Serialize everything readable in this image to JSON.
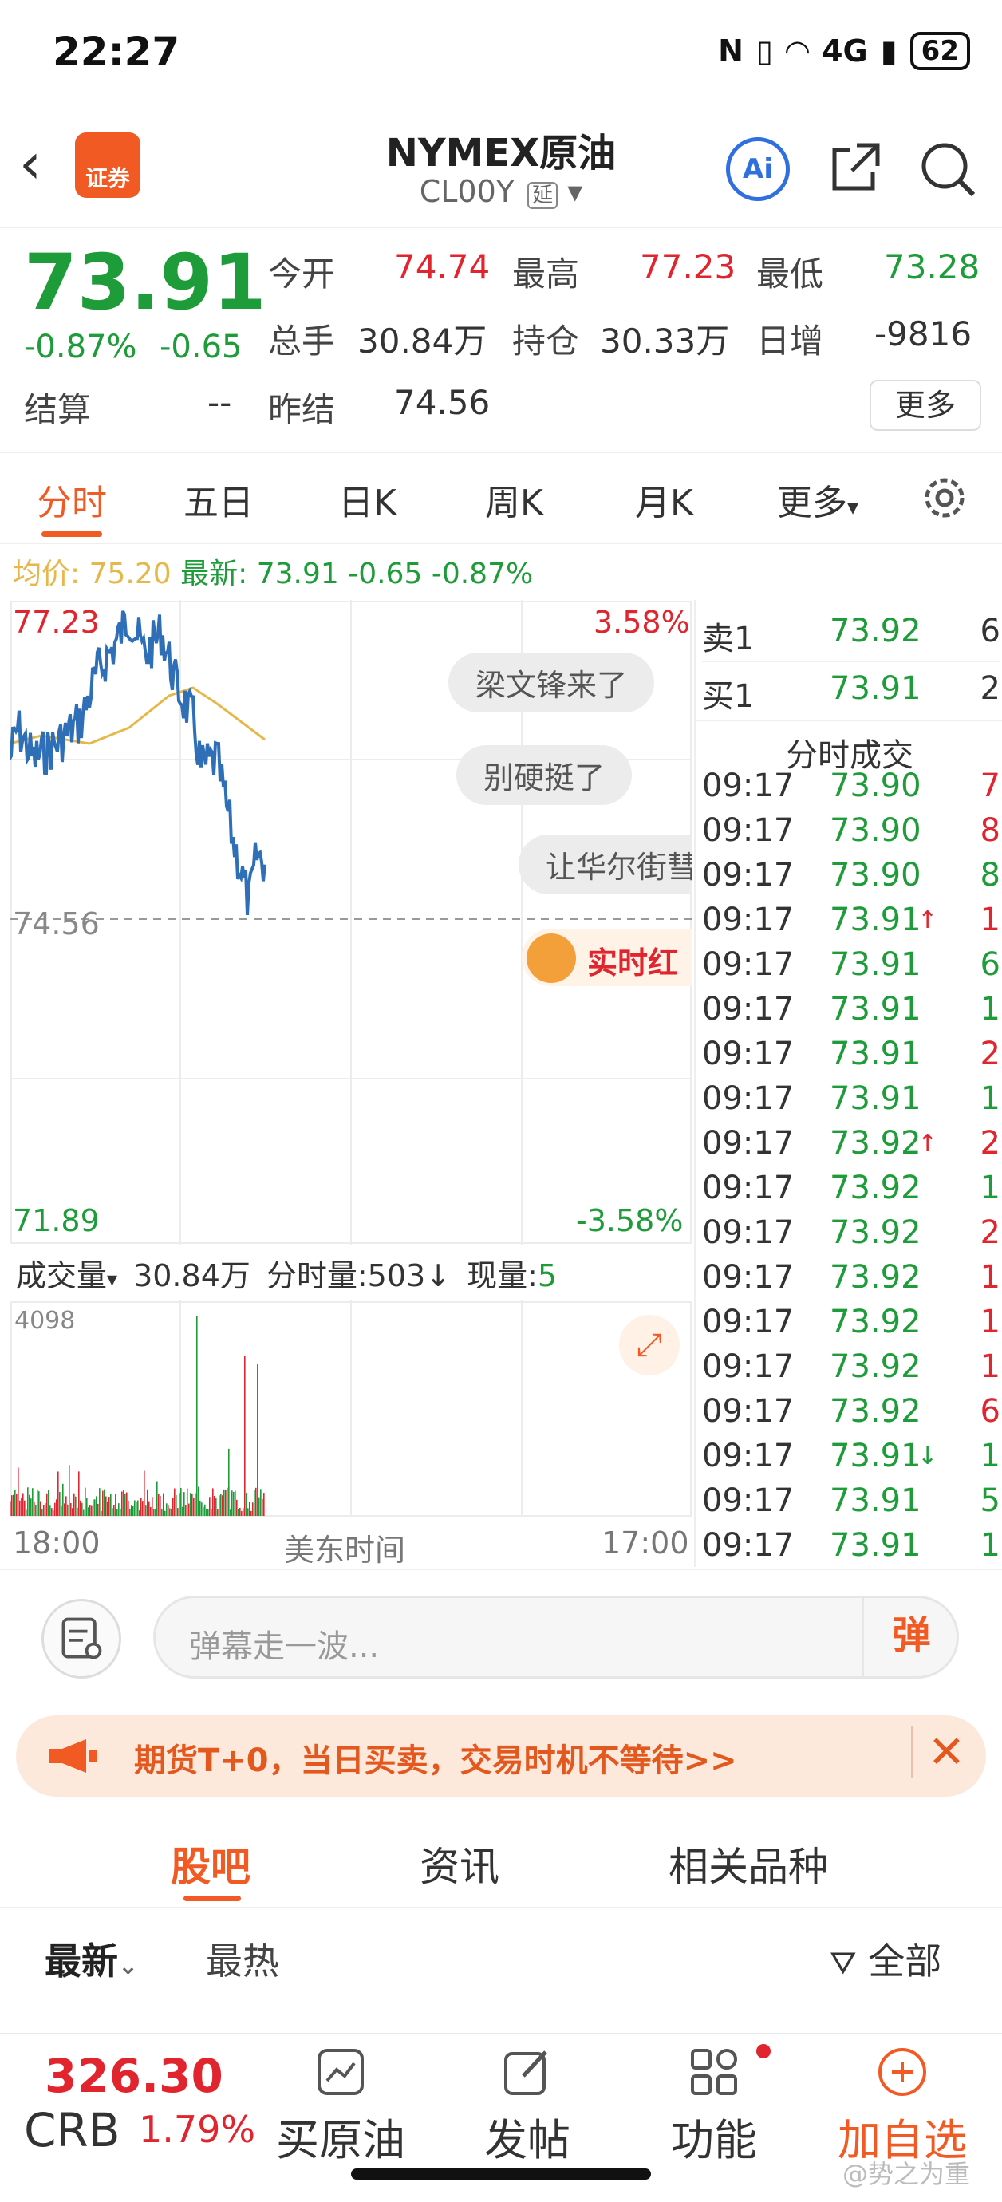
{
  "status_bar": {
    "time": "22:27",
    "network": "4G",
    "battery": "62"
  },
  "header": {
    "title": "NYMEX原油",
    "code": "CL00Y",
    "code_tag": "延",
    "broker_logo": "证券",
    "ai_label": "Ai"
  },
  "quote": {
    "last": "73.91",
    "change_pct": "-0.87%",
    "change_abs": "-0.65",
    "fields": [
      {
        "label": "今开",
        "value": "74.74",
        "color": "red"
      },
      {
        "label": "最高",
        "value": "77.23",
        "color": "red"
      },
      {
        "label": "最低",
        "value": "73.28",
        "color": "green"
      },
      {
        "label": "总手",
        "value": "30.84万",
        "color": "dark"
      },
      {
        "label": "持仓",
        "value": "30.33万",
        "color": "dark"
      },
      {
        "label": "日增",
        "value": "-9816",
        "color": "dark"
      }
    ],
    "settle_label": "结算",
    "settle_value": "--",
    "prev_settle_label": "昨结",
    "prev_settle_value": "74.56",
    "more_button": "更多"
  },
  "chart_tabs": [
    "分时",
    "五日",
    "日K",
    "周K",
    "月K",
    "更多"
  ],
  "avg_line": {
    "avg_label": "均价:",
    "avg_value": "75.20",
    "latest_label": "最新:",
    "latest_value": "73.91",
    "change_abs": "-0.65",
    "change_pct": "-0.87%"
  },
  "chart_labels": {
    "high": "77.23",
    "low": "71.89",
    "ref": "74.56",
    "high_pct": "3.58%",
    "low_pct": "-3.58%"
  },
  "danmaku": [
    "梁文锋来了",
    "别硬挺了",
    "让华尔街彗"
  ],
  "hongbao_text": "实时红",
  "volume": {
    "label": "成交量",
    "total": "30.84万",
    "tick_label": "分时量:503",
    "tick_arrow": "↓",
    "current_label": "现量:",
    "current_value": "5",
    "max": "4098"
  },
  "x_axis": {
    "start": "18:00",
    "mid": "美东时间",
    "end": "17:00"
  },
  "order_book": [
    {
      "side": "卖1",
      "price": "73.92",
      "qty": "6"
    },
    {
      "side": "买1",
      "price": "73.91",
      "qty": "2"
    }
  ],
  "ticks_title": "分时成交",
  "ticks": [
    {
      "time": "09:17",
      "price": "73.90",
      "arrow": "",
      "vol": "7",
      "color": "red"
    },
    {
      "time": "09:17",
      "price": "73.90",
      "arrow": "",
      "vol": "8",
      "color": "red"
    },
    {
      "time": "09:17",
      "price": "73.90",
      "arrow": "",
      "vol": "8",
      "color": "green"
    },
    {
      "time": "09:17",
      "price": "73.91",
      "arrow": "↑",
      "vol": "1",
      "color": "red"
    },
    {
      "time": "09:17",
      "price": "73.91",
      "arrow": "",
      "vol": "6",
      "color": "green"
    },
    {
      "time": "09:17",
      "price": "73.91",
      "arrow": "",
      "vol": "1",
      "color": "green"
    },
    {
      "time": "09:17",
      "price": "73.91",
      "arrow": "",
      "vol": "2",
      "color": "red"
    },
    {
      "time": "09:17",
      "price": "73.91",
      "arrow": "",
      "vol": "1",
      "color": "green"
    },
    {
      "time": "09:17",
      "price": "73.92",
      "arrow": "↑",
      "vol": "2",
      "color": "red"
    },
    {
      "time": "09:17",
      "price": "73.92",
      "arrow": "",
      "vol": "1",
      "color": "green"
    },
    {
      "time": "09:17",
      "price": "73.92",
      "arrow": "",
      "vol": "2",
      "color": "red"
    },
    {
      "time": "09:17",
      "price": "73.92",
      "arrow": "",
      "vol": "1",
      "color": "red"
    },
    {
      "time": "09:17",
      "price": "73.92",
      "arrow": "",
      "vol": "1",
      "color": "red"
    },
    {
      "time": "09:17",
      "price": "73.92",
      "arrow": "",
      "vol": "1",
      "color": "red"
    },
    {
      "time": "09:17",
      "price": "73.92",
      "arrow": "",
      "vol": "6",
      "color": "red"
    },
    {
      "time": "09:17",
      "price": "73.91",
      "arrow": "↓",
      "vol": "1",
      "color": "green"
    },
    {
      "time": "09:17",
      "price": "73.91",
      "arrow": "",
      "vol": "5",
      "color": "green"
    },
    {
      "time": "09:17",
      "price": "73.91",
      "arrow": "",
      "vol": "1",
      "color": "green"
    }
  ],
  "comment": {
    "placeholder": "弹幕走一波...",
    "send": "弹"
  },
  "promo": "期货T+0，当日买卖，交易时机不等待>>",
  "community_tabs": [
    "股吧",
    "资讯",
    "相关品种"
  ],
  "sort": {
    "latest": "最新",
    "hot": "最热",
    "filter": "全部"
  },
  "bottom_bar": {
    "index_price": "326.30",
    "index_name": "CRB",
    "index_change": "1.79%",
    "buttons": [
      "买原油",
      "发帖",
      "功能",
      "加自选"
    ]
  },
  "watermark": "@势之为重",
  "colors": {
    "up": "#e0252e",
    "down": "#1f9c3a",
    "accent": "#f25a23",
    "line": "#2f6fb8",
    "avg": "#e6b84a"
  }
}
